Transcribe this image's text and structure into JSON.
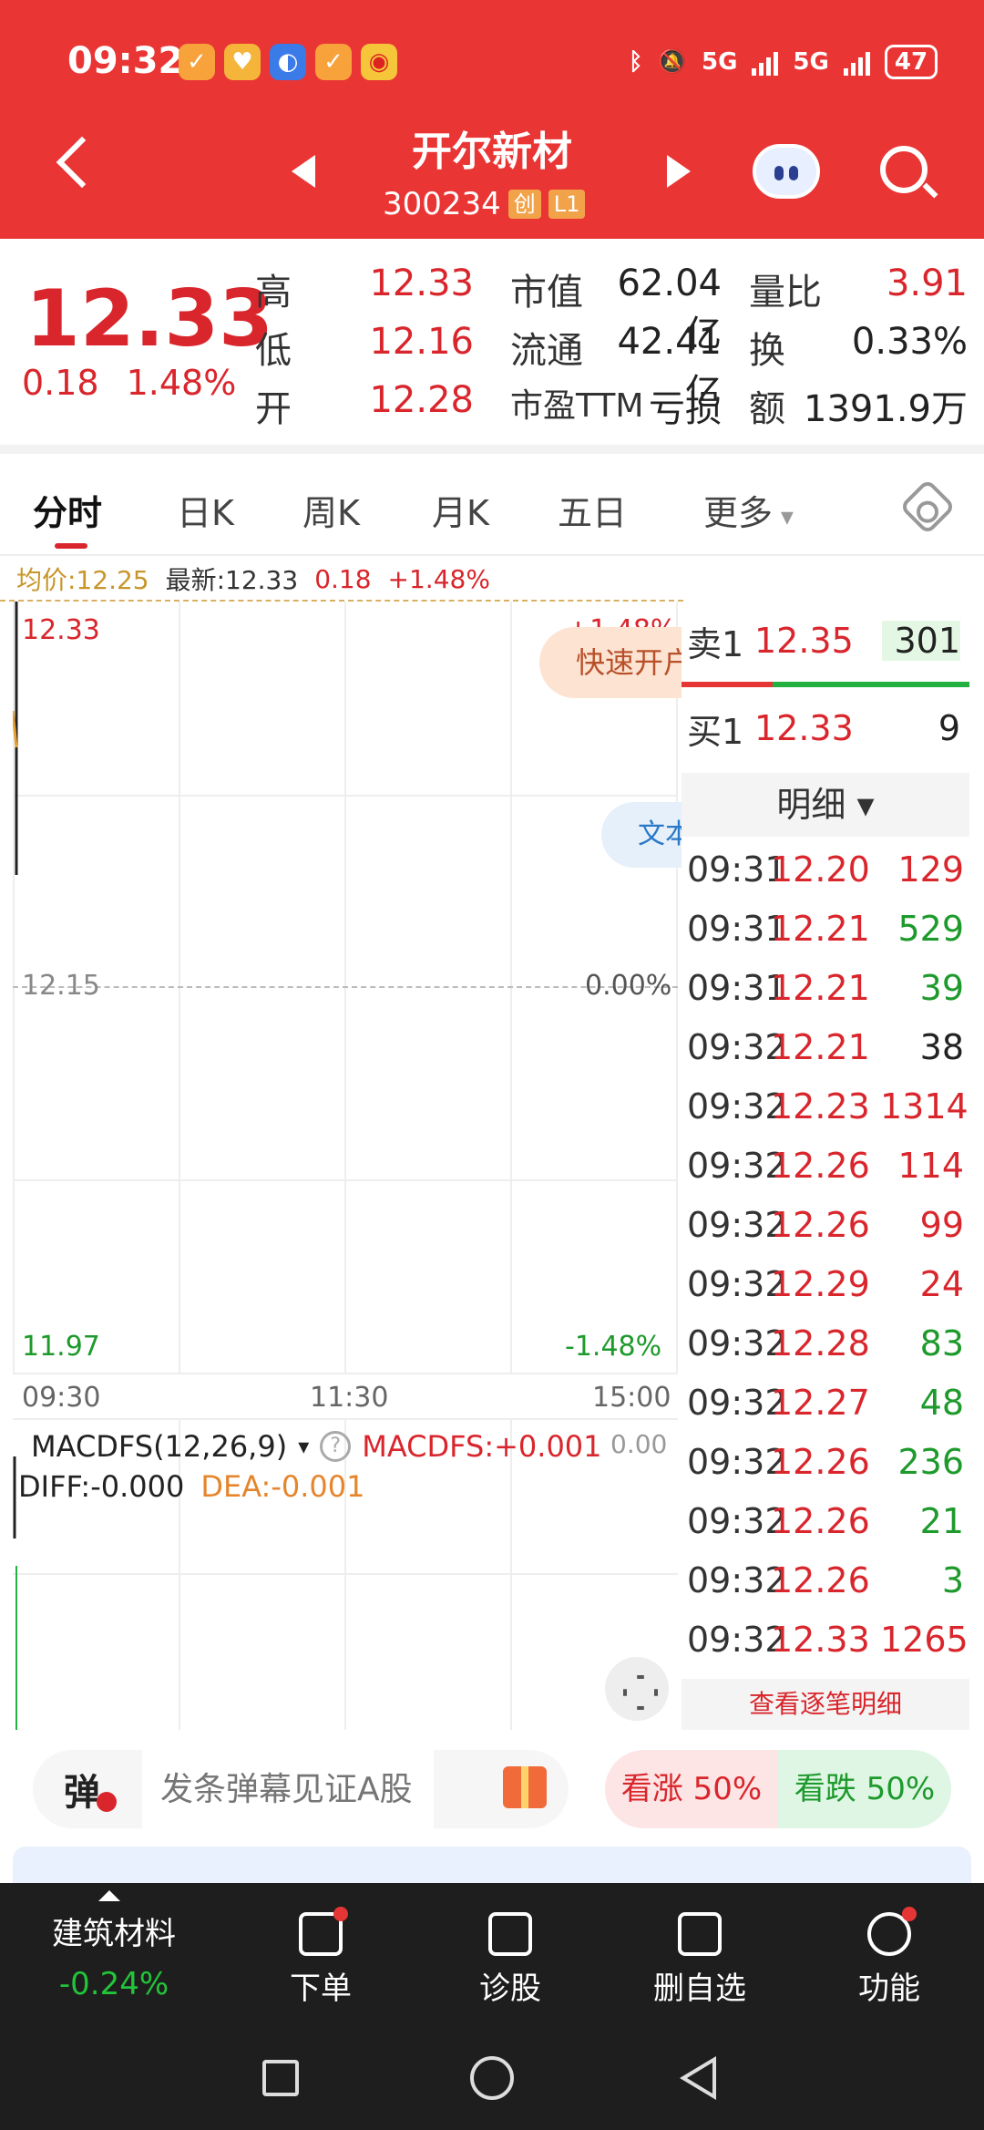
{
  "status_bar": {
    "time": "09:32",
    "network": "5G",
    "battery": "47"
  },
  "nav": {
    "stock_name": "开尔新材",
    "stock_code": "300234",
    "board_tag": "创",
    "level_tag": "L1"
  },
  "quote": {
    "price": "12.33",
    "change": "0.18",
    "change_pct": "1.48%",
    "rows": [
      {
        "l1": "高",
        "v1": "12.33",
        "l2": "市值",
        "v2": "62.04亿",
        "l3": "量比",
        "v3": "3.91"
      },
      {
        "l1": "低",
        "v1": "12.16",
        "l2": "流通",
        "v2": "42.41亿",
        "l3": "换",
        "v3": "0.33%"
      },
      {
        "l1": "开",
        "v1": "12.28",
        "l2": "市盈TTM",
        "v2": "亏损",
        "l3": "额",
        "v3": "1391.9万"
      }
    ]
  },
  "tabs": [
    "分时",
    "日K",
    "周K",
    "月K",
    "五日",
    "更多"
  ],
  "infobar": {
    "avg": "均价:12.25",
    "latest": "最新:12.33",
    "chg": "0.18",
    "pct": "+1.48%"
  },
  "chart": {
    "y_top": "12.33",
    "y_mid": "12.15",
    "y_bot": "11.97",
    "pct_top": "+1.48%",
    "pct_mid": "0.00%",
    "pct_bot": "-1.48%",
    "x_labels": [
      "09:30",
      "11:30",
      "15:00"
    ],
    "quick_open": "快速开户",
    "text_pill": "文本"
  },
  "macd": {
    "name": "MACDFS(12,26,9)",
    "value": "MACDFS:+0.001",
    "zero": "0.00",
    "diff": "DIFF:-0.000",
    "dea": "DEA:-0.001"
  },
  "book": {
    "ask_label": "卖1",
    "ask_price": "12.35",
    "ask_vol": "301",
    "bid_label": "买1",
    "bid_price": "12.33",
    "bid_vol": "9",
    "detail_title": "明细 ▾",
    "detail_link": "查看逐笔明细"
  },
  "ticks": [
    {
      "t": "09:31",
      "p": "12.20",
      "v": "129",
      "pc": "red",
      "vc": "red"
    },
    {
      "t": "09:31",
      "p": "12.21",
      "v": "529",
      "pc": "red",
      "vc": "green"
    },
    {
      "t": "09:31",
      "p": "12.21",
      "v": "39",
      "pc": "red",
      "vc": "green"
    },
    {
      "t": "09:32",
      "p": "12.21",
      "v": "38",
      "pc": "red",
      "vc": "dark"
    },
    {
      "t": "09:32",
      "p": "12.23",
      "v": "1314",
      "pc": "red",
      "vc": "red"
    },
    {
      "t": "09:32",
      "p": "12.26",
      "v": "114",
      "pc": "red",
      "vc": "red"
    },
    {
      "t": "09:32",
      "p": "12.26",
      "v": "99",
      "pc": "red",
      "vc": "red"
    },
    {
      "t": "09:32",
      "p": "12.29",
      "v": "24",
      "pc": "red",
      "vc": "red"
    },
    {
      "t": "09:32",
      "p": "12.28",
      "v": "83",
      "pc": "red",
      "vc": "green"
    },
    {
      "t": "09:32",
      "p": "12.27",
      "v": "48",
      "pc": "red",
      "vc": "green"
    },
    {
      "t": "09:32",
      "p": "12.26",
      "v": "236",
      "pc": "red",
      "vc": "green"
    },
    {
      "t": "09:32",
      "p": "12.26",
      "v": "21",
      "pc": "red",
      "vc": "green"
    },
    {
      "t": "09:32",
      "p": "12.26",
      "v": "3",
      "pc": "red",
      "vc": "green"
    },
    {
      "t": "09:32",
      "p": "12.33",
      "v": "1265",
      "pc": "red",
      "vc": "red"
    }
  ],
  "danmu": {
    "tag": "弹",
    "placeholder": "发条弹幕见证A股",
    "rise": "看涨 50%",
    "fall": "看跌 50%"
  },
  "bottom": {
    "sector": "建筑材料",
    "sector_chg": "-0.24%",
    "order": "下单",
    "diagnose": "诊股",
    "remove": "删自选",
    "func": "功能"
  },
  "colors": {
    "header": "#ea3535",
    "up": "#d9262c",
    "down": "#1e9a2c"
  }
}
